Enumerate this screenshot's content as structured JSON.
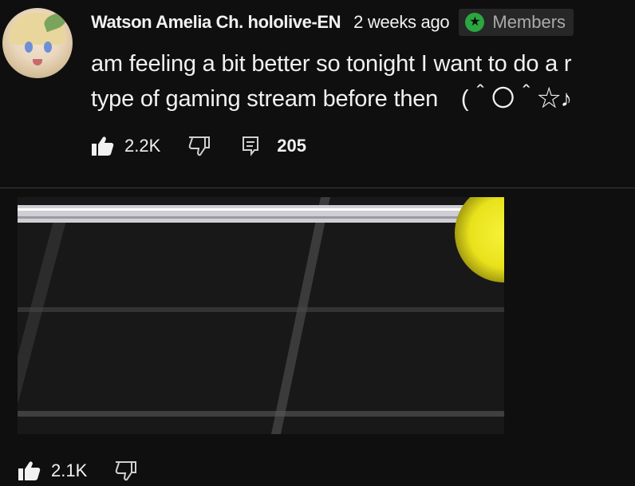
{
  "comment": {
    "author": "Watson Amelia Ch. hololive-EN",
    "time": "2 weeks ago",
    "badge_label": "Members",
    "badge_icon": "star-icon",
    "text_lines": [
      "am feeling a bit better so tonight I want to do a r",
      "type of gaming stream before then　(＾〇＾☆♪"
    ],
    "likes": "2.2K",
    "replies": "205",
    "colors": {
      "background": "#0f0f0f",
      "text": "#f1f1f1",
      "badge_bg": "#272727",
      "badge_star": "#2ba640",
      "muted": "#aaaaaa"
    }
  },
  "next_post": {
    "likes": "2.1K"
  }
}
